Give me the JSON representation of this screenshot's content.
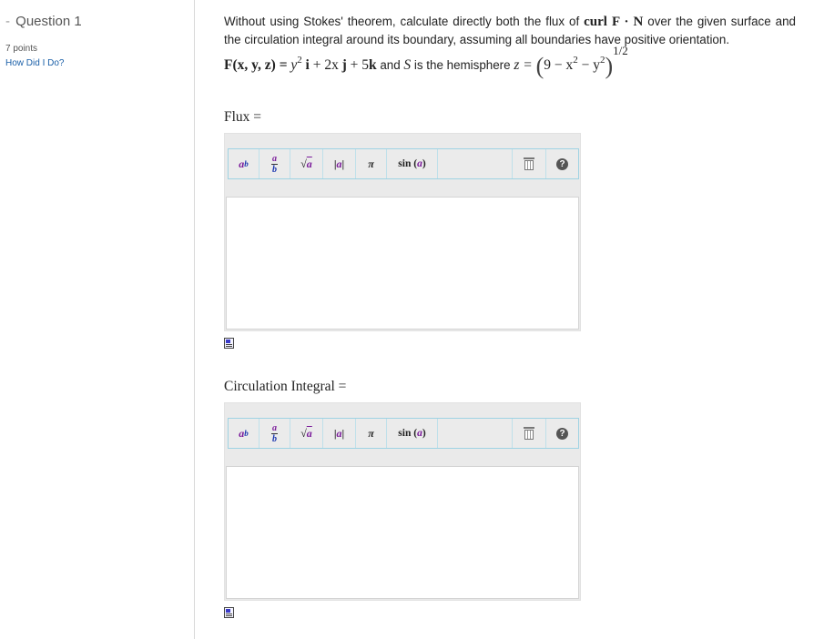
{
  "question": {
    "dash": "-",
    "title": "Question 1",
    "points": "7 points",
    "help_link": "How Did I Do?"
  },
  "problem": {
    "text_1": "Without using Stokes' theorem, calculate directly both the flux of",
    "curl_expr": "curl F · N",
    "text_2": "over the given surface and the circulation integral around its boundary, assuming all boundaries have positive orientation.",
    "formula": {
      "F_def": "F(x, y, z) = ",
      "y": "y",
      "y_pow": "2",
      "i": "i",
      "plus_2x": " + 2x",
      "j": "j",
      "plus_5": " + 5",
      "k": "k",
      "and_text": " and ",
      "S": "S",
      "hemisphere_text": " is the hemisphere ",
      "z_eq": "z = ",
      "lparen": "(",
      "nine_minus": "9 − x",
      "x_pow": "2",
      "minus_y": " − y",
      "y2_pow": "2",
      "rparen": ")",
      "outer_pow": "1/2"
    }
  },
  "answers": [
    {
      "label": "Flux =",
      "toolbar": {
        "power_base": "a",
        "power_exp": "b",
        "frac_num": "a",
        "frac_den": "b",
        "sqrt_sym": "√",
        "sqrt_arg": "a",
        "abs_bar": "|",
        "abs_arg": "a",
        "pi": "π",
        "sin_fn": "sin",
        "sin_open": "(",
        "sin_arg": "a",
        "sin_close": ")",
        "help_glyph": "?"
      },
      "value": ""
    },
    {
      "label": "Circulation Integral =",
      "toolbar": {
        "power_base": "a",
        "power_exp": "b",
        "frac_num": "a",
        "frac_den": "b",
        "sqrt_sym": "√",
        "sqrt_arg": "a",
        "abs_bar": "|",
        "abs_arg": "a",
        "pi": "π",
        "sin_fn": "sin",
        "sin_open": "(",
        "sin_arg": "a",
        "sin_close": ")",
        "help_glyph": "?"
      },
      "value": ""
    }
  ]
}
